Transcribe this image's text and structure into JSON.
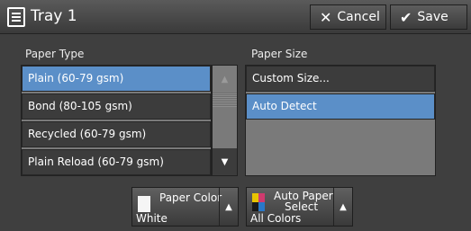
{
  "header": {
    "title": "Tray 1",
    "cancel_label": "Cancel",
    "save_label": "Save"
  },
  "paper_type": {
    "label": "Paper Type",
    "items": [
      {
        "label": "Plain (60-79 gsm)",
        "selected": true
      },
      {
        "label": "Bond (80-105 gsm)",
        "selected": false
      },
      {
        "label": "Recycled (60-79 gsm)",
        "selected": false
      },
      {
        "label": "Plain Reload (60-79 gsm)",
        "selected": false
      }
    ]
  },
  "paper_size": {
    "label": "Paper Size",
    "items": [
      {
        "label": "Custom Size...",
        "selected": false
      },
      {
        "label": "Auto Detect",
        "selected": true
      }
    ]
  },
  "bottom": {
    "paper_color": {
      "title": "Paper Color",
      "value": "White"
    },
    "auto_paper": {
      "title_line1": "Auto Paper",
      "title_line2": "Select",
      "value": "All Colors"
    }
  },
  "icons": {
    "tray": "tray-icon",
    "cancel": "x-icon",
    "save": "check-icon",
    "scroll_up": "up-arrow-icon",
    "scroll_down": "down-arrow-icon",
    "expand": "up-triangle-icon"
  },
  "colors": {
    "selected": "#5b8fc8",
    "background": "#3f3f3f"
  }
}
